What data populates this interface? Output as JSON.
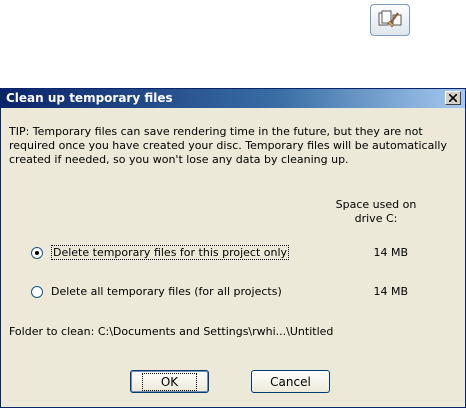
{
  "toolbar": {
    "cleanup_icon": "cleanup-files-icon"
  },
  "dialog": {
    "title": "Clean up temporary files",
    "tip": "TIP: Temporary files can save rendering time in the future, but they are not required once you have created your disc. Temporary files will be automatically created if needed, so you won't lose any data by cleaning up.",
    "space_header_line1": "Space used on",
    "space_header_line2": "drive C:",
    "options": [
      {
        "label": "Delete temporary files for this project only",
        "size": "14 MB",
        "selected": true
      },
      {
        "label": "Delete all temporary files (for all projects)",
        "size": "14 MB",
        "selected": false
      }
    ],
    "folder_text": "Folder to clean: C:\\Documents and Settings\\rwhi...\\Untitled",
    "ok_label": "OK",
    "cancel_label": "Cancel"
  }
}
